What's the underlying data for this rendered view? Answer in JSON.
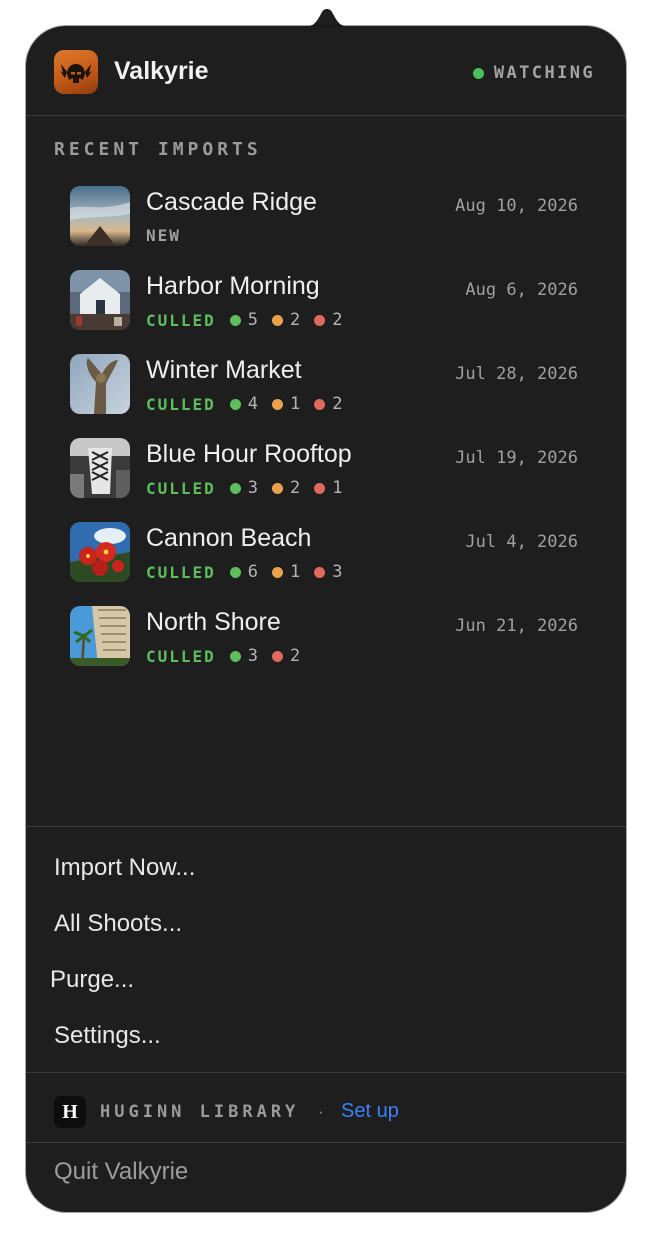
{
  "header": {
    "app_name": "Valkyrie",
    "status_label": "WATCHING",
    "status_color": "#4cc05a",
    "icon": "valkyrie-helmet-icon"
  },
  "recent": {
    "section_title": "RECENT IMPORTS",
    "items": [
      {
        "title": "Cascade Ridge",
        "date": "Aug 10, 2026",
        "tag": "NEW",
        "counts": []
      },
      {
        "title": "Harbor Morning",
        "date": "Aug 6, 2026",
        "tag": "CULLED",
        "counts": [
          {
            "color": "green",
            "value": "5"
          },
          {
            "color": "orange",
            "value": "2"
          },
          {
            "color": "red",
            "value": "2"
          }
        ]
      },
      {
        "title": "Winter Market",
        "date": "Jul 28, 2026",
        "tag": "CULLED",
        "counts": [
          {
            "color": "green",
            "value": "4"
          },
          {
            "color": "orange",
            "value": "1"
          },
          {
            "color": "red",
            "value": "2"
          }
        ]
      },
      {
        "title": "Blue Hour Rooftop",
        "date": "Jul 19, 2026",
        "tag": "CULLED",
        "counts": [
          {
            "color": "green",
            "value": "3"
          },
          {
            "color": "orange",
            "value": "2"
          },
          {
            "color": "red",
            "value": "1"
          }
        ]
      },
      {
        "title": "Cannon Beach",
        "date": "Jul 4, 2026",
        "tag": "CULLED",
        "counts": [
          {
            "color": "green",
            "value": "6"
          },
          {
            "color": "orange",
            "value": "1"
          },
          {
            "color": "red",
            "value": "3"
          }
        ]
      },
      {
        "title": "North Shore",
        "date": "Jun 21, 2026",
        "tag": "CULLED",
        "counts": [
          {
            "color": "green",
            "value": "3"
          },
          {
            "color": "red",
            "value": "2"
          }
        ]
      }
    ]
  },
  "colors": {
    "green": "#5cbf5c",
    "orange": "#eba04b",
    "red": "#e0685c"
  },
  "menu": {
    "import_now": "Import Now...",
    "all_shoots": "All Shoots...",
    "purge": "Purge...",
    "settings": "Settings..."
  },
  "huginn": {
    "logo_letter": "H",
    "label": "HUGINN LIBRARY",
    "separator": "·",
    "link": "Set up"
  },
  "quit_label": "Quit Valkyrie"
}
